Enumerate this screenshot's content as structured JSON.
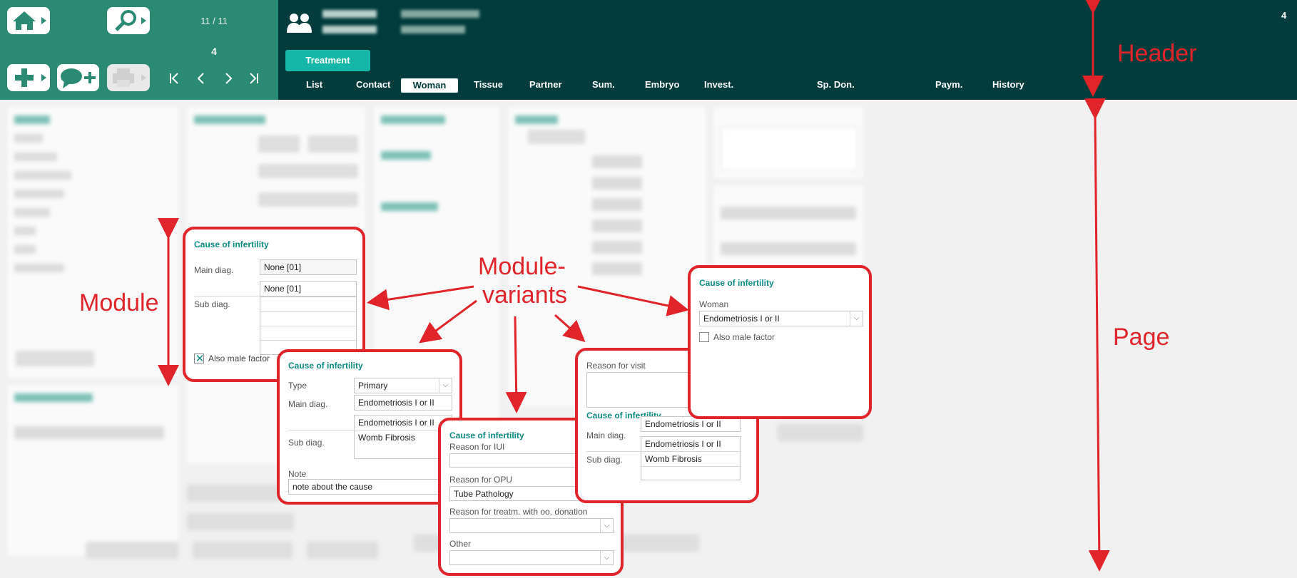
{
  "header": {
    "record_counter": "11 / 11",
    "record_number": "4",
    "corner_number": "4",
    "treatment_button": "Treatment",
    "tabs": [
      "List",
      "Contact",
      "Woman",
      "Tissue",
      "Partner",
      "Sum.",
      "Embryo",
      "Invest.",
      "Sp. Don.",
      "Paym.",
      "History"
    ],
    "icons": [
      "home-icon",
      "search-icon",
      "add-icon",
      "comment-add-icon",
      "print-icon",
      "first-icon",
      "prev-icon",
      "next-icon",
      "last-icon",
      "patients-icon"
    ]
  },
  "cards": {
    "module": {
      "title": "Cause of infertility",
      "main_diag_label": "Main diag.",
      "main_diag_value": "None [01]",
      "main_diag_value2": "None [01]",
      "sub_diag_label": "Sub diag.",
      "also_male_factor": "Also male factor",
      "also_male_checked": true
    },
    "variant_type": {
      "title": "Cause of infertility",
      "type_label": "Type",
      "type_value": "Primary",
      "main_diag_label": "Main diag.",
      "main_diag_value": "Endometriosis I or II",
      "main_diag_value2": "Endometriosis I or II",
      "sub_diag_label": "Sub diag.",
      "sub_diag_value": "Womb Fibrosis",
      "note_label": "Note",
      "note_value": "note about the cause"
    },
    "variant_reasons": {
      "title": "Cause of infertility",
      "reason_iui_label": "Reason for IUI",
      "reason_opu_label": "Reason for OPU",
      "reason_opu_value": "Tube Pathology",
      "reason_oo_label": "Reason for treatm. with oo. donation",
      "other_label": "Other"
    },
    "variant_visit": {
      "reason_visit_label": "Reason for visit",
      "title": "Cause of infertility",
      "main_diag_label": "Main diag.",
      "main_diag_value": "Endometriosis I or II",
      "main_diag_value2": "Endometriosis I or II",
      "sub_diag_label": "Sub diag.",
      "sub_diag_value": "Womb Fibrosis"
    },
    "variant_woman": {
      "title": "Cause of infertility",
      "woman_label": "Woman",
      "woman_value": "Endometriosis I or II",
      "also_male_factor": "Also male factor",
      "also_male_checked": false
    }
  },
  "annotations": {
    "header": "Header",
    "module": "Module",
    "variants_line1": "Module-",
    "variants_line2": "variants",
    "page": "Page"
  },
  "colors": {
    "header_bg": "#003c3c",
    "header_left_bg": "#2b8a73",
    "accent": "#16b7a9",
    "annotation": "#e1232a",
    "card_title": "#0d8b84"
  }
}
